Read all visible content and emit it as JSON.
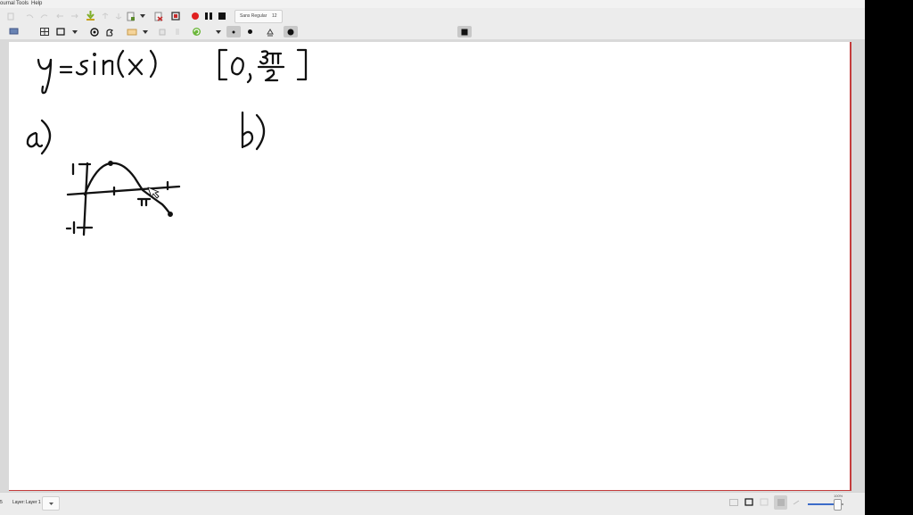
{
  "menu": {
    "journal": "ournal",
    "tools": "Tools",
    "help": "Help"
  },
  "toolbar": {
    "font_name": "Sans Regular",
    "font_size": "12",
    "colors": [
      "#111111",
      "#1a8a2a",
      "#2aa3d8",
      "#27b24a",
      "#767676",
      "#3636a8",
      "#c8282e",
      "#b03aa8",
      "#e0821e",
      "#e6d21e",
      "#f4f4f4"
    ]
  },
  "status": {
    "page_no": "5",
    "layer_label": "Layer:",
    "layer_value": "Layer 1",
    "zoom": "100%"
  },
  "handwriting": {
    "equation": "y = sin(x)",
    "interval": "[0, 3π/2]",
    "part_a": "a)",
    "part_b": "b)",
    "tick_top": "1",
    "tick_bottom": "-1",
    "tick_pi": "π"
  }
}
